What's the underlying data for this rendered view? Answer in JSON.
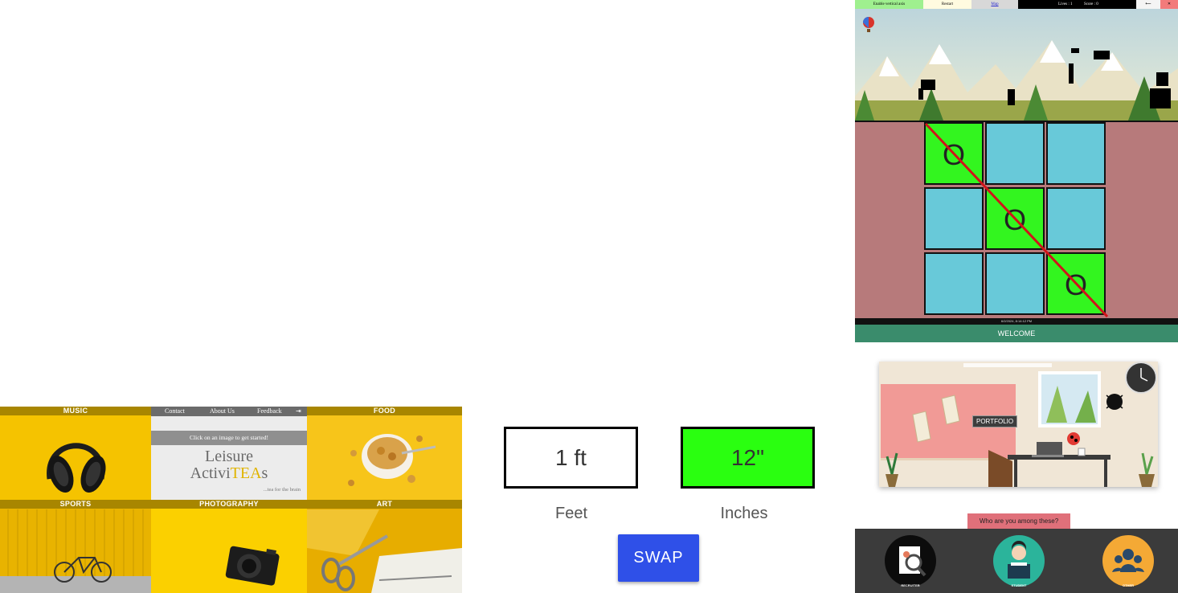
{
  "leisure": {
    "tiles": {
      "music": "MUSIC",
      "food": "FOOD",
      "sports": "SPORTS",
      "photography": "PHOTOGRAPHY",
      "art": "ART"
    },
    "nav": {
      "contact": "Contact",
      "about": "About Us",
      "feedback": "Feedback",
      "arrow": "⇥"
    },
    "prompt": "Click on an image to get started!",
    "title_line1": "Leisure",
    "title_pre": "Activi",
    "title_tea": "TEA",
    "title_post": "s",
    "tagline": "...tea for the brain"
  },
  "converter": {
    "left_value": "1 ft",
    "right_value": "12\"",
    "left_label": "Feet",
    "right_label": "Inches",
    "swap_label": "SWAP",
    "right_color": "#2aff10"
  },
  "game": {
    "toggle_label": "Enable vertical axis",
    "restart_label": "Restart",
    "map_label": "Map",
    "lives_label": "Lives : 1",
    "score_label": "Score : 0",
    "back_label": "⟵",
    "close_label": "✕"
  },
  "tictactoe": {
    "cells": [
      "O",
      "",
      "",
      "",
      "O",
      "",
      "",
      "",
      "O"
    ],
    "win_cells": [
      0,
      4,
      8
    ],
    "win_color": "#33f51f",
    "empty_color": "#68c9d9",
    "status": "6/2/2024, 8:14:12 PM",
    "welcome": "WELCOME"
  },
  "portfolio": {
    "sign": "PORTFOLIO",
    "who_label": "Who are you among these?",
    "roles": [
      "RECRUITER",
      "STUDENT",
      "OTHER"
    ]
  }
}
